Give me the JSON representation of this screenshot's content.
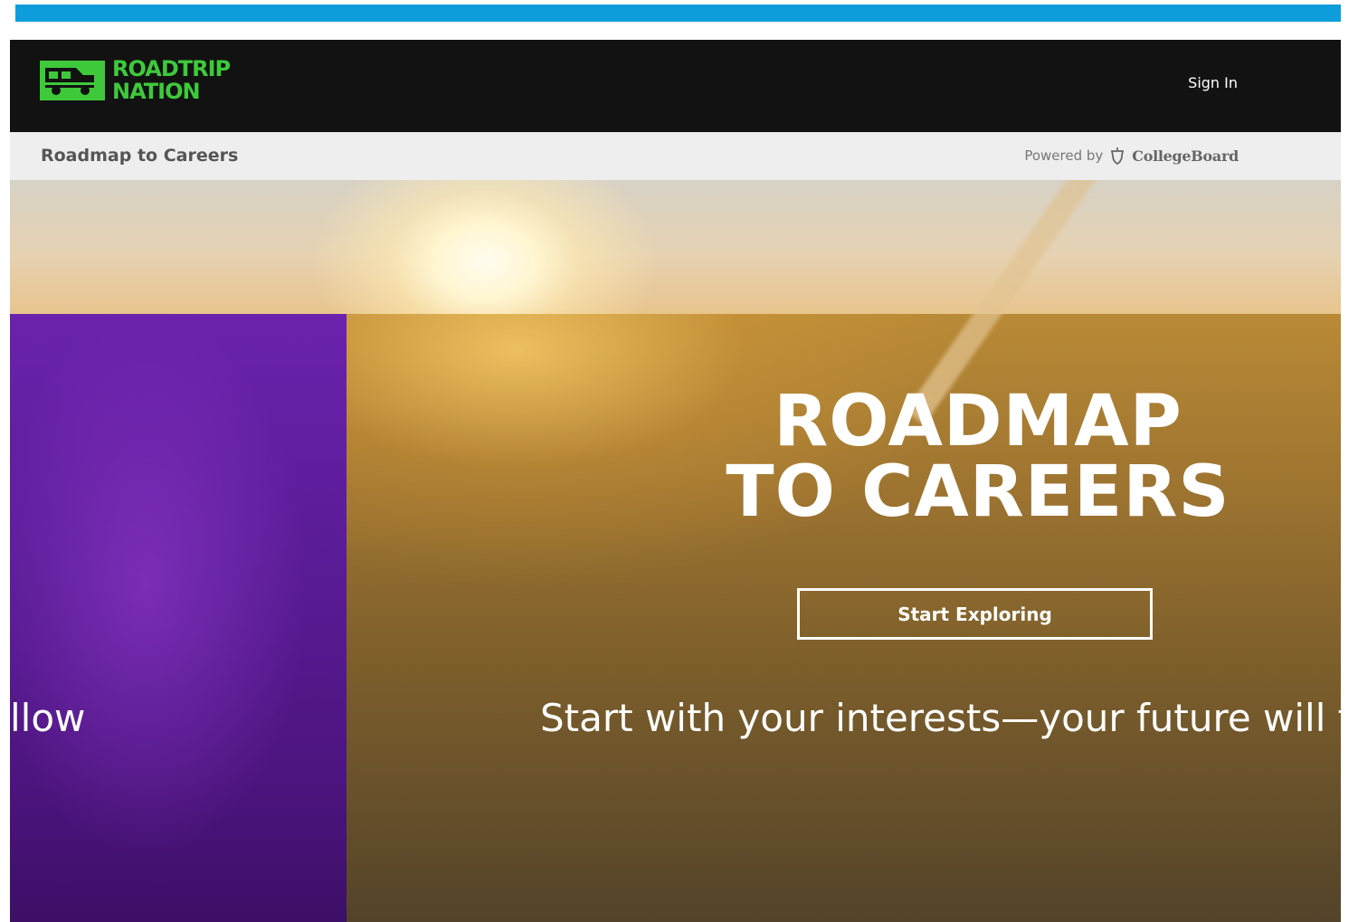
{
  "accent_color": "#0d9ddb",
  "brand": {
    "logo_line1": "ROADTRIP",
    "logo_line2": "NATION",
    "logo_color": "#3ec93b"
  },
  "nav": {
    "sign_in_label": "Sign In"
  },
  "subnav": {
    "title": "Roadmap to Careers",
    "powered_by_label": "Powered by",
    "partner_name": "CollegeBoard"
  },
  "hero": {
    "title_line1": "ROADMAP",
    "title_line2": "TO CAREERS",
    "cta_label": "Start Exploring",
    "tagline_visible": "Start with your interests—your future will fo",
    "tagline_wrapped": "llow",
    "purple_panel_color": "#5a1c96"
  }
}
